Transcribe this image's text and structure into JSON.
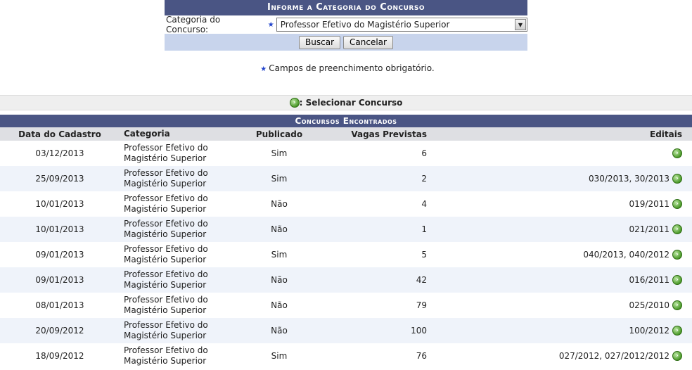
{
  "search_form": {
    "caption": "Informe a Categoria do Concurso",
    "field_label": "Categoria do Concurso:",
    "selected_value": "Professor Efetivo do Magistério Superior",
    "buscar": "Buscar",
    "cancelar": "Cancelar"
  },
  "required_note": "Campos de preenchimento obrigatório.",
  "legend": ": Selecionar Concurso",
  "results": {
    "caption": "Concursos Encontrados",
    "headers": [
      "Data do Cadastro",
      "Categoria",
      "Publicado",
      "Vagas Previstas",
      "Editais"
    ],
    "rows": [
      {
        "date": "03/12/2013",
        "categoria": [
          "Professor Efetivo do",
          "Magistério Superior"
        ],
        "publicado": "Sim",
        "vagas": "6",
        "editais": ""
      },
      {
        "date": "25/09/2013",
        "categoria": [
          "Professor Efetivo do",
          "Magistério Superior"
        ],
        "publicado": "Sim",
        "vagas": "2",
        "editais": "030/2013, 30/2013"
      },
      {
        "date": "10/01/2013",
        "categoria": [
          "Professor Efetivo do",
          "Magistério Superior"
        ],
        "publicado": "Não",
        "vagas": "4",
        "editais": "019/2011"
      },
      {
        "date": "10/01/2013",
        "categoria": [
          "Professor Efetivo do",
          "Magistério Superior"
        ],
        "publicado": "Não",
        "vagas": "1",
        "editais": "021/2011"
      },
      {
        "date": "09/01/2013",
        "categoria": [
          "Professor Efetivo do",
          "Magistério Superior"
        ],
        "publicado": "Sim",
        "vagas": "5",
        "editais": "040/2013, 040/2012"
      },
      {
        "date": "09/01/2013",
        "categoria": [
          "Professor Efetivo do",
          "Magistério Superior"
        ],
        "publicado": "Não",
        "vagas": "42",
        "editais": "016/2011"
      },
      {
        "date": "08/01/2013",
        "categoria": [
          "Professor Efetivo do",
          "Magistério Superior"
        ],
        "publicado": "Não",
        "vagas": "79",
        "editais": "025/2010"
      },
      {
        "date": "20/09/2012",
        "categoria": [
          "Professor Efetivo do",
          "Magistério Superior"
        ],
        "publicado": "Não",
        "vagas": "100",
        "editais": "100/2012"
      },
      {
        "date": "18/09/2012",
        "categoria": [
          "Professor Efetivo do",
          "Magistério Superior"
        ],
        "publicado": "Sim",
        "vagas": "76",
        "editais": "027/2012, 027/2012/2012"
      }
    ]
  }
}
